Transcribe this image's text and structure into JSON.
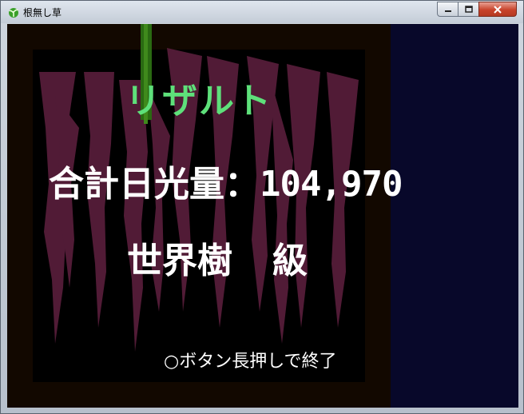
{
  "window": {
    "title": "根無し草",
    "icon": "sprout-icon",
    "controls": [
      "minimize-icon",
      "maximize-icon",
      "close-icon"
    ]
  },
  "result": {
    "heading": "リザルト",
    "total_label": "合計日光量：",
    "total_value": "104,970",
    "rank_label": "世界樹",
    "rank_grade": "級",
    "hint": "○ボタン長押しで終了"
  },
  "colors": {
    "heading": "#5ee07a",
    "text": "#ffffff",
    "frame": "#120800",
    "side_panel": "#08082a",
    "roots": "#5a1f3c",
    "sprout": "#2a6a12"
  }
}
